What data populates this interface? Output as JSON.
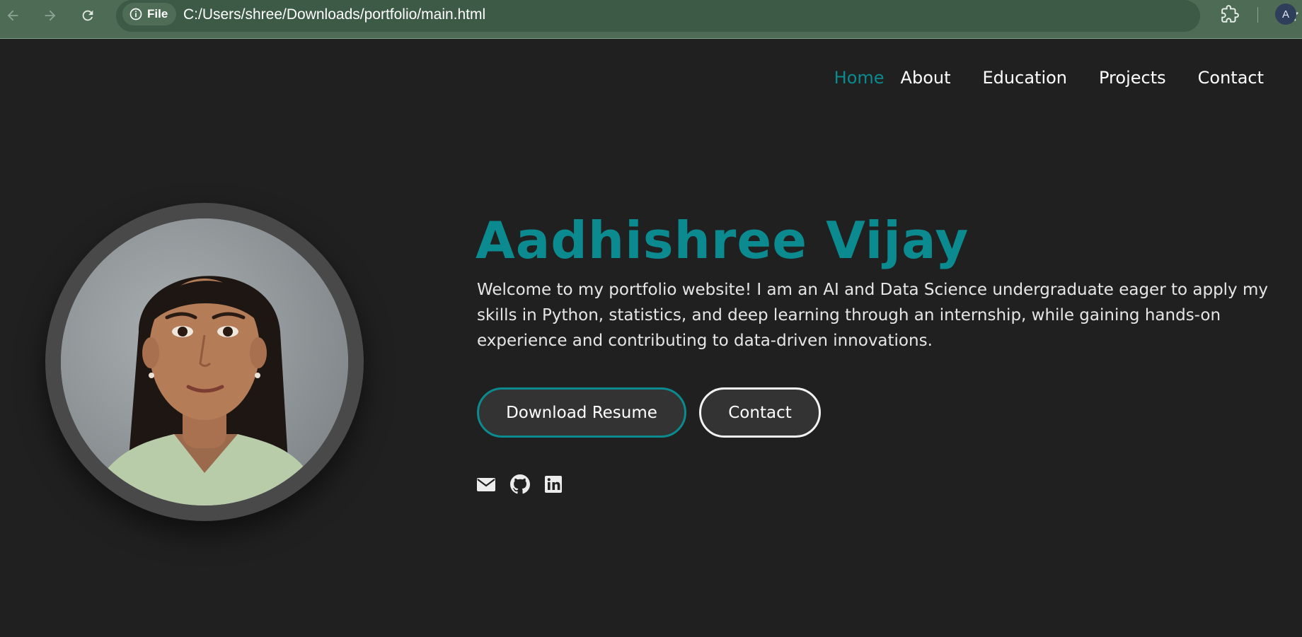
{
  "browser": {
    "site_chip_label": "File",
    "url": "C:/Users/shree/Downloads/portfolio/main.html",
    "profile_initial": "A"
  },
  "nav": {
    "items": [
      {
        "label": "Home",
        "active": true
      },
      {
        "label": "About",
        "active": false
      },
      {
        "label": "Education",
        "active": false
      },
      {
        "label": "Projects",
        "active": false
      },
      {
        "label": "Contact",
        "active": false
      }
    ]
  },
  "hero": {
    "name": "Aadhishree Vijay",
    "intro": "Welcome to my portfolio website! I am an AI and Data Science undergraduate eager to apply my skills in Python, statistics, and deep learning through an internship, while gaining hands-on experience and contributing to data-driven innovations.",
    "buttons": {
      "resume": "Download Resume",
      "contact": "Contact"
    },
    "social_icons": [
      "email-icon",
      "github-icon",
      "linkedin-icon"
    ]
  },
  "colors": {
    "accent": "#0b8a8f",
    "page_background": "#202020",
    "chrome_background": "#4d6b55",
    "text": "#ffffff"
  }
}
